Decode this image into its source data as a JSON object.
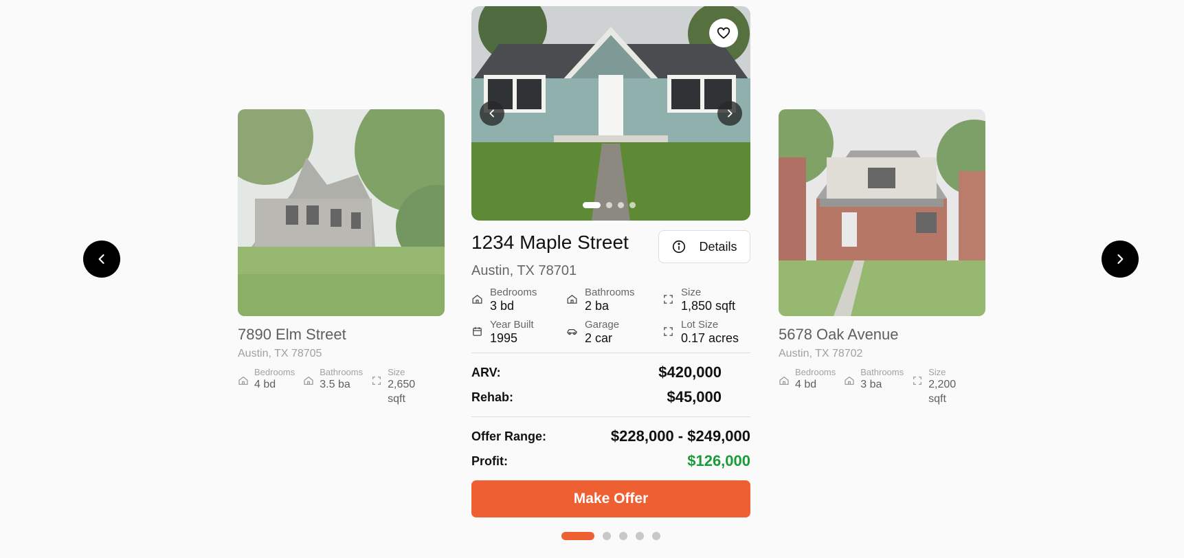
{
  "carousel": {
    "prev_label": "Previous property",
    "next_label": "Next property",
    "page_count": 5,
    "active_page": 1
  },
  "colors": {
    "accent": "#ee6032",
    "profit": "#1a9b3a",
    "dark": "#000000"
  },
  "left_card": {
    "title": "7890 Elm Street",
    "address": "Austin, TX 78705",
    "stats": [
      {
        "icon": "home-icon",
        "label": "Bedrooms",
        "value": "4 bd"
      },
      {
        "icon": "home-icon",
        "label": "Bathrooms",
        "value": "3.5 ba"
      },
      {
        "icon": "size-icon",
        "label": "Size",
        "value": "2,650 sqft"
      }
    ]
  },
  "right_card": {
    "title": "5678 Oak Avenue",
    "address": "Austin, TX 78702",
    "stats": [
      {
        "icon": "home-icon",
        "label": "Bedrooms",
        "value": "4 bd"
      },
      {
        "icon": "home-icon",
        "label": "Bathrooms",
        "value": "3 ba"
      },
      {
        "icon": "size-icon",
        "label": "Size",
        "value": "2,200 sqft"
      }
    ]
  },
  "main_card": {
    "title": "1234 Maple Street",
    "address": "Austin, TX 78701",
    "details_label": "Details",
    "photo_count": 4,
    "active_photo": 1,
    "facts": [
      {
        "icon": "home-icon",
        "label": "Bedrooms",
        "value": "3 bd"
      },
      {
        "icon": "home-icon",
        "label": "Bathrooms",
        "value": "2 ba"
      },
      {
        "icon": "size-icon",
        "label": "Size",
        "value": "1,850 sqft"
      },
      {
        "icon": "calendar-icon",
        "label": "Year Built",
        "value": "1995"
      },
      {
        "icon": "car-icon",
        "label": "Garage",
        "value": "2 car"
      },
      {
        "icon": "size-icon",
        "label": "Lot Size",
        "value": "0.17 acres"
      }
    ],
    "arv_label": "ARV:",
    "arv_value": "$420,000",
    "rehab_label": "Rehab:",
    "rehab_value": "$45,000",
    "offer_range_label": "Offer Range:",
    "offer_range_value": "$228,000 - $249,000",
    "profit_label": "Profit:",
    "profit_value": "$126,000",
    "make_offer_label": "Make Offer"
  }
}
